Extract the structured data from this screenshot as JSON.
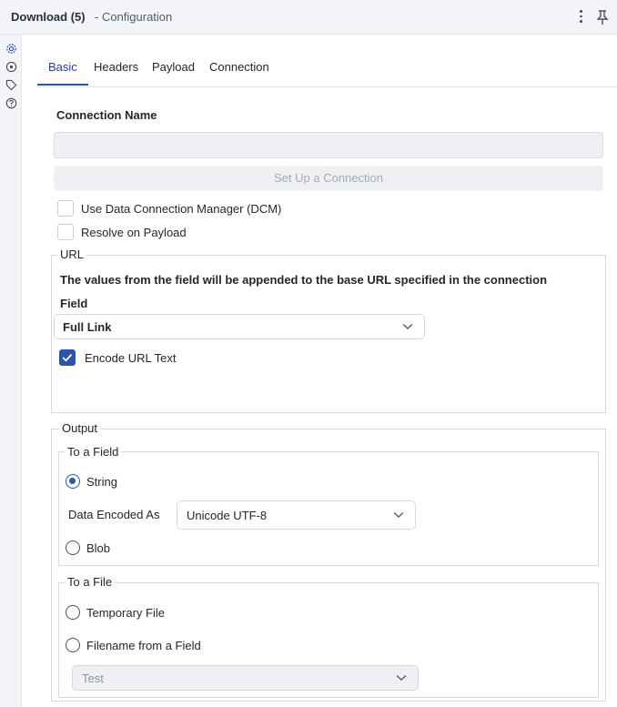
{
  "header": {
    "title": "Download (5)",
    "subtitle": "- Configuration",
    "icons": [
      "more-vertical-icon",
      "pin-icon"
    ]
  },
  "rail": {
    "icons": [
      "gear-icon",
      "target-icon",
      "tag-icon",
      "help-icon"
    ]
  },
  "tabs": [
    {
      "label": "Basic",
      "active": true
    },
    {
      "label": "Headers",
      "active": false
    },
    {
      "label": "Payload",
      "active": false
    },
    {
      "label": "Connection",
      "active": false
    }
  ],
  "connection": {
    "label": "Connection Name",
    "value": "",
    "setup_button": "Set Up a Connection"
  },
  "checkboxes": {
    "dcm": {
      "label": "Use Data Connection Manager (DCM)",
      "checked": false
    },
    "resolve": {
      "label": "Resolve on Payload",
      "checked": false
    }
  },
  "url": {
    "legend": "URL",
    "description": "The values from the field will be appended to the base URL specified in the connection",
    "field_label": "Field",
    "field_value": "Full Link",
    "encode": {
      "label": "Encode URL Text",
      "checked": true
    }
  },
  "output": {
    "legend": "Output",
    "to_field": {
      "legend": "To a Field",
      "string_label": "String",
      "string_selected": true,
      "encoded_as_label": "Data Encoded As",
      "encoded_as_value": "Unicode UTF-8",
      "blob_label": "Blob",
      "blob_selected": false
    },
    "to_file": {
      "legend": "To a File",
      "temp_label": "Temporary File",
      "filename_label": "Filename from a Field",
      "filename_field_value": "Test"
    }
  },
  "colors": {
    "accent": "#2c55a6",
    "panel_bg": "#f3f4f7",
    "disabled_bg": "#eef0f3"
  }
}
